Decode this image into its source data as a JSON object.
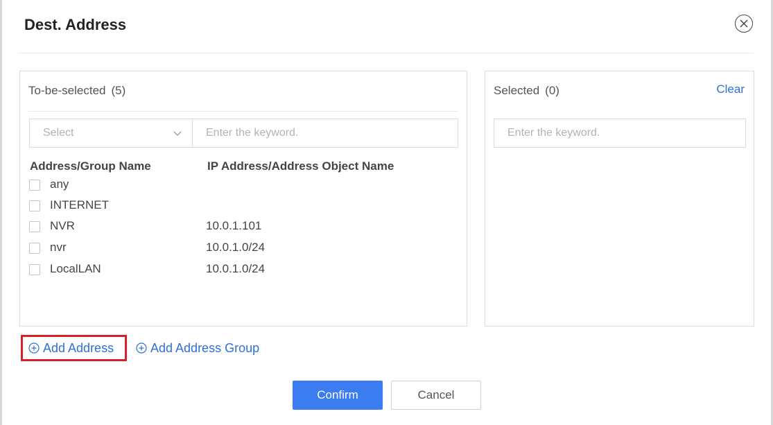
{
  "dialog": {
    "title": "Dest. Address",
    "close_icon": "close-circle-icon"
  },
  "to_be_selected": {
    "title": "To-be-selected",
    "count": "(5)",
    "select_placeholder": "Select",
    "search_placeholder": "Enter the keyword.",
    "columns": [
      "Address/Group Name",
      "IP Address/Address Object Name"
    ],
    "rows": [
      {
        "name": "any",
        "ip": ""
      },
      {
        "name": "INTERNET",
        "ip": ""
      },
      {
        "name": "NVR",
        "ip": "10.0.1.101"
      },
      {
        "name": "nvr",
        "ip": "10.0.1.0/24"
      },
      {
        "name": "LocalLAN",
        "ip": "10.0.1.0/24"
      }
    ]
  },
  "selected": {
    "title": "Selected",
    "count": "(0)",
    "clear_label": "Clear",
    "search_placeholder": "Enter the keyword."
  },
  "links": {
    "add_address": "Add Address",
    "add_address_group": "Add Address Group"
  },
  "buttons": {
    "confirm": "Confirm",
    "cancel": "Cancel"
  },
  "colors": {
    "accent": "#3b7cf0",
    "link": "#2f6fd6",
    "highlight": "#d9202a"
  }
}
